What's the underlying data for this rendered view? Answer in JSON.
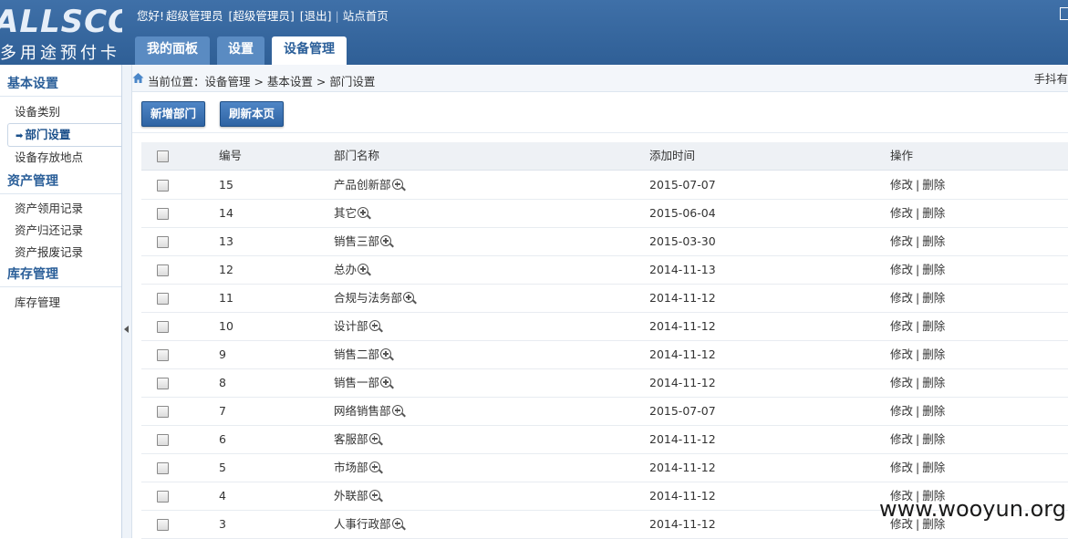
{
  "logo": {
    "main": "ALLSCORE",
    "sub": "多用途预付卡"
  },
  "userbar": {
    "greeting": "您好!",
    "user": "超级管理员",
    "role": "[超级管理员]",
    "logout": "[退出]",
    "home": "站点首页"
  },
  "tabs": [
    {
      "label": "我的面板",
      "active": false
    },
    {
      "label": "设置",
      "active": false
    },
    {
      "label": "设备管理",
      "active": true
    }
  ],
  "sidebar": {
    "groups": [
      {
        "title": "基本设置",
        "items": [
          {
            "label": "设备类别",
            "active": false
          },
          {
            "label": "部门设置",
            "active": true
          },
          {
            "label": "设备存放地点",
            "active": false
          }
        ]
      },
      {
        "title": "资产管理",
        "items": [
          {
            "label": "资产领用记录",
            "active": false
          },
          {
            "label": "资产归还记录",
            "active": false
          },
          {
            "label": "资产报废记录",
            "active": false
          }
        ]
      },
      {
        "title": "库存管理",
        "items": [
          {
            "label": "库存管理",
            "active": false
          }
        ]
      }
    ]
  },
  "breadcrumb": {
    "text": "当前位置：设备管理 > 基本设置 > 部门设置",
    "right": "手抖有"
  },
  "toolbar": {
    "add_label": "新增部门",
    "refresh_label": "刷新本页"
  },
  "table": {
    "headers": {
      "id": "编号",
      "name": "部门名称",
      "time": "添加时间",
      "ops": "操作"
    },
    "edit_label": "修改",
    "delete_label": "删除",
    "rows": [
      {
        "id": "15",
        "name": "产品创新部",
        "time": "2015-07-07"
      },
      {
        "id": "14",
        "name": "其它",
        "time": "2015-06-04"
      },
      {
        "id": "13",
        "name": "销售三部",
        "time": "2015-03-30"
      },
      {
        "id": "12",
        "name": "总办",
        "time": "2014-11-13"
      },
      {
        "id": "11",
        "name": "合规与法务部",
        "time": "2014-11-12"
      },
      {
        "id": "10",
        "name": "设计部",
        "time": "2014-11-12"
      },
      {
        "id": "9",
        "name": "销售二部",
        "time": "2014-11-12"
      },
      {
        "id": "8",
        "name": "销售一部",
        "time": "2014-11-12"
      },
      {
        "id": "7",
        "name": "网络销售部",
        "time": "2015-07-07"
      },
      {
        "id": "6",
        "name": "客服部",
        "time": "2014-11-12"
      },
      {
        "id": "5",
        "name": "市场部",
        "time": "2014-11-12"
      },
      {
        "id": "4",
        "name": "外联部",
        "time": "2014-11-12"
      },
      {
        "id": "3",
        "name": "人事行政部",
        "time": "2014-11-12"
      }
    ]
  },
  "watermark": "www.wooyun.org"
}
